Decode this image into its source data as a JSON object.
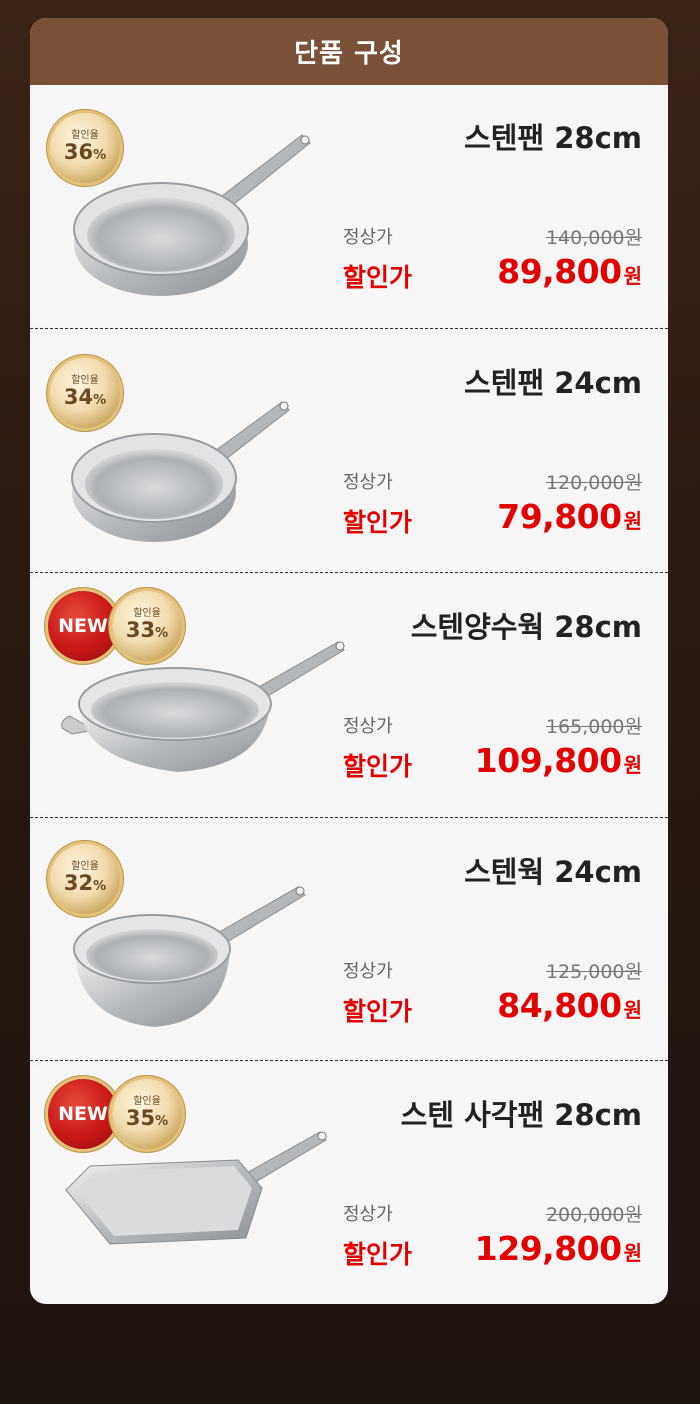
{
  "header": {
    "title": "단품 구성"
  },
  "labels": {
    "regular": "정상가",
    "sale": "할인가",
    "won": "원",
    "discount": "할인율",
    "new": "NEW",
    "percent": "%"
  },
  "products": [
    {
      "name": "스텐팬 28cm",
      "regular_price": "140,000원",
      "sale_price": "89,800",
      "discount": "36",
      "is_new": false
    },
    {
      "name": "스텐팬 24cm",
      "regular_price": "120,000원",
      "sale_price": "79,800",
      "discount": "34",
      "is_new": false
    },
    {
      "name": "스텐양수웍 28cm",
      "regular_price": "165,000원",
      "sale_price": "109,800",
      "discount": "33",
      "is_new": true
    },
    {
      "name": "스텐웍 24cm",
      "regular_price": "125,000원",
      "sale_price": "84,800",
      "discount": "32",
      "is_new": false
    },
    {
      "name": "스텐 사각팬 28cm",
      "regular_price": "200,000원",
      "sale_price": "129,800",
      "discount": "35",
      "is_new": true
    }
  ],
  "colors": {
    "header_bg": "#7a5038",
    "sale_red": "#e20000",
    "badge_gold": "#c9a45a",
    "badge_new_red": "#c81717"
  }
}
